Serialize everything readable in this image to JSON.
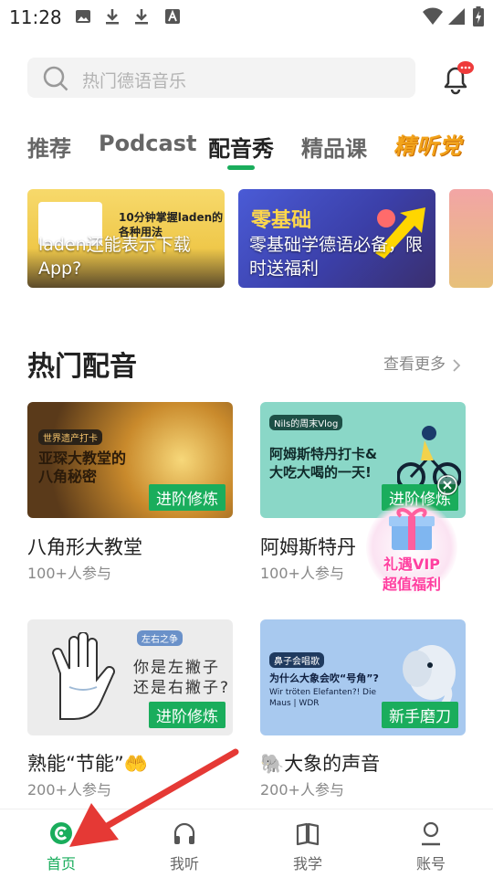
{
  "status_bar": {
    "time": "11:28"
  },
  "search": {
    "placeholder": "热门德语音乐"
  },
  "tabs": [
    {
      "label": "推荐"
    },
    {
      "label": "Podcast"
    },
    {
      "label": "配音秀"
    },
    {
      "label": "精品课"
    }
  ],
  "tabs_special": {
    "label": "精听党"
  },
  "banners": [
    {
      "text": "laden还能表示下载App?",
      "art_line1": "10分钟掌握laden的",
      "art_line2": "各种用法"
    },
    {
      "text": "零基础学德语必备，限时送福利",
      "art_title": "零基础"
    }
  ],
  "section": {
    "title": "热门配音",
    "more": "查看更多"
  },
  "cards": [
    {
      "title": "八角形大教堂",
      "participants": "100+人参与",
      "tag": "进阶修炼",
      "art_label": "世界遗产打卡",
      "art_title1": "亚琛大教堂的",
      "art_title2": "八角秘密"
    },
    {
      "title": "阿姆斯特丹",
      "participants": "100+人参与",
      "tag": "进阶修炼",
      "art_label": "Nils的周末Vlog",
      "art_title1": "阿姆斯特丹打卡&",
      "art_title2": "大吃大喝的一天!"
    },
    {
      "title": "熟能“节能”🤲",
      "participants": "200+人参与",
      "tag": "进阶修炼",
      "art_label": "左右之争",
      "art_title1": "你是左撇子",
      "art_title2": "还是右撇子?"
    },
    {
      "title": "🐘大象的声音",
      "participants": "200+人参与",
      "tag": "新手磨刀",
      "art_label": "鼻子会唱歌",
      "art_title1": "为什么大象会吹“号角”?",
      "art_title2": "Wir tröten Elefanten?! Die Maus | WDR"
    }
  ],
  "promo": {
    "line1": "礼遇VIP",
    "line2": "超值福利"
  },
  "nav": [
    {
      "label": "首页"
    },
    {
      "label": "我听"
    },
    {
      "label": "我学"
    },
    {
      "label": "账号"
    }
  ],
  "colors": {
    "accent": "#1aad5c",
    "arrow": "#e53935"
  }
}
